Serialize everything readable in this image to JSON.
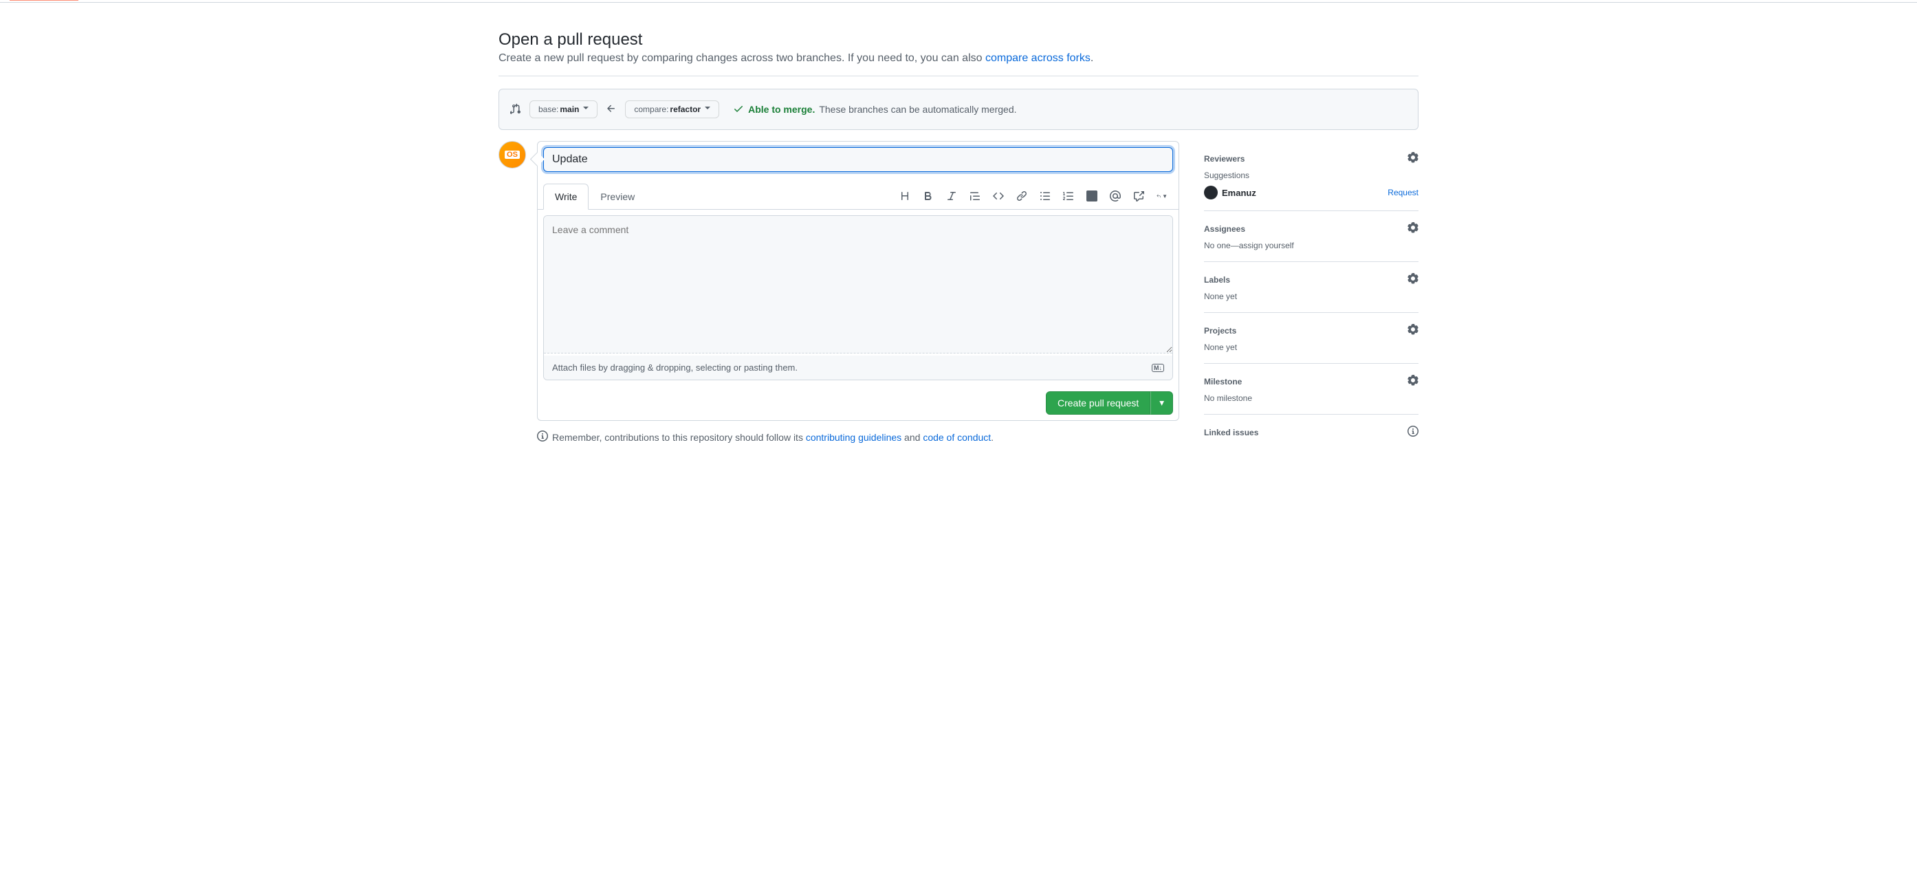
{
  "page": {
    "title": "Open a pull request",
    "subtitle_prefix": "Create a new pull request by comparing changes across two branches. If you need to, you can also ",
    "subtitle_link": "compare across forks",
    "subtitle_suffix": "."
  },
  "compare": {
    "base_prefix": "base: ",
    "base_branch": "main",
    "compare_prefix": "compare: ",
    "compare_branch": "refactor",
    "able_label": "Able to merge.",
    "detail": "These branches can be automatically merged."
  },
  "form": {
    "title_value": "Update",
    "tabs": {
      "write": "Write",
      "preview": "Preview"
    },
    "comment_placeholder": "Leave a comment",
    "attach_hint": "Attach files by dragging & dropping, selecting or pasting them.",
    "submit_label": "Create pull request"
  },
  "footer": {
    "prefix": "Remember, contributions to this repository should follow its ",
    "link1": "contributing guidelines",
    "middle": " and ",
    "link2": "code of conduct",
    "suffix": "."
  },
  "sidebar": {
    "reviewers": {
      "title": "Reviewers",
      "suggestions_label": "Suggestions",
      "user": "Emanuz",
      "request_label": "Request"
    },
    "assignees": {
      "title": "Assignees",
      "prefix": "No one—",
      "link": "assign yourself"
    },
    "labels": {
      "title": "Labels",
      "value": "None yet"
    },
    "projects": {
      "title": "Projects",
      "value": "None yet"
    },
    "milestone": {
      "title": "Milestone",
      "value": "No milestone"
    },
    "linked": {
      "title": "Linked issues"
    }
  },
  "avatar_text": "OS"
}
